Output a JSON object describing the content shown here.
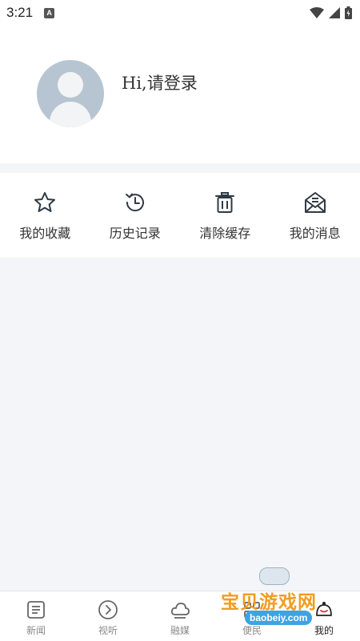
{
  "status_bar": {
    "time": "3:21",
    "notification_badge": "A"
  },
  "profile": {
    "greeting": "Hi,请登录"
  },
  "actions": [
    {
      "label": "我的收藏",
      "icon": "star-icon"
    },
    {
      "label": "历史记录",
      "icon": "history-clock-icon"
    },
    {
      "label": "清除缓存",
      "icon": "trash-icon"
    },
    {
      "label": "我的消息",
      "icon": "mail-icon"
    }
  ],
  "tabs": [
    {
      "label": "新闻",
      "icon": "news-icon",
      "active": false
    },
    {
      "label": "视听",
      "icon": "play-circle-icon",
      "active": false
    },
    {
      "label": "融媒",
      "icon": "cloud-icon",
      "active": false
    },
    {
      "label": "便民",
      "icon": "services-icon",
      "active": false
    },
    {
      "label": "我的",
      "icon": "profile-icon",
      "active": true
    }
  ],
  "watermark": {
    "text": "宝贝游戏网",
    "url": "baobeiy.com"
  },
  "colors": {
    "page_background": "#f3f5f8",
    "avatar": "#b6c5d1",
    "icon": "#2f3a44",
    "watermark_orange": "#f39c1f",
    "watermark_blue": "#3fa3e0"
  }
}
